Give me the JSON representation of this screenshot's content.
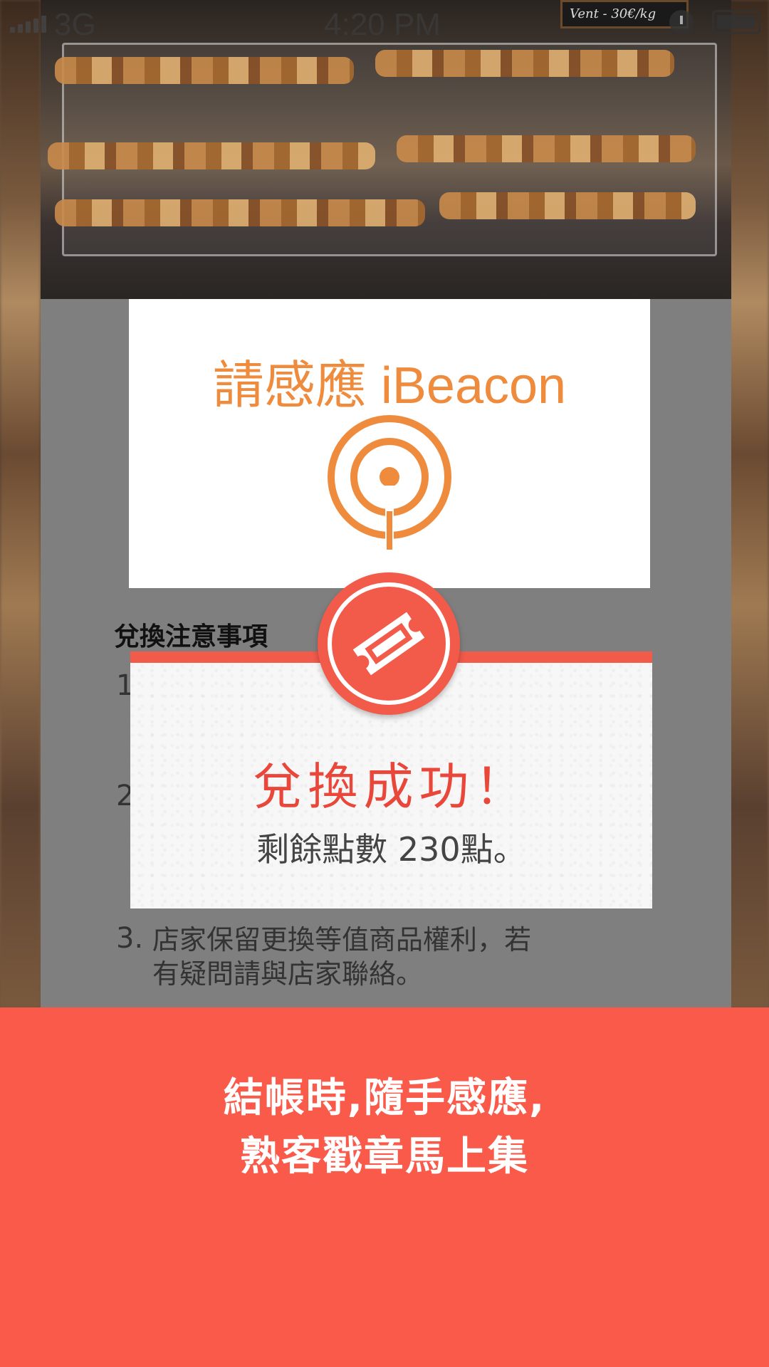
{
  "status_bar": {
    "carrier": "3G",
    "time": "4:20 PM"
  },
  "photo": {
    "sign_text": "Vent - 30€/kg"
  },
  "beacon_card": {
    "title": "請感應 iBeacon",
    "icon": "beacon-signal-icon",
    "accent_color": "#ef8b3c"
  },
  "notes": {
    "title": "兌換注意事項",
    "items": [
      {
        "number": "1.",
        "text": ""
      },
      {
        "number": "2.",
        "text": ""
      },
      {
        "number": "3.",
        "text": "店家保留更換等值商品權利，若有疑問請與店家聯絡。"
      }
    ]
  },
  "popup": {
    "icon": "ticket-icon",
    "title": "兌換成功！",
    "message": "剩餘點數 230點。",
    "accent_color": "#f25a4a"
  },
  "promo": {
    "line1": "結帳時,隨手感應,",
    "line2": "熟客戳章馬上集",
    "background_color": "#fa5a4a"
  }
}
